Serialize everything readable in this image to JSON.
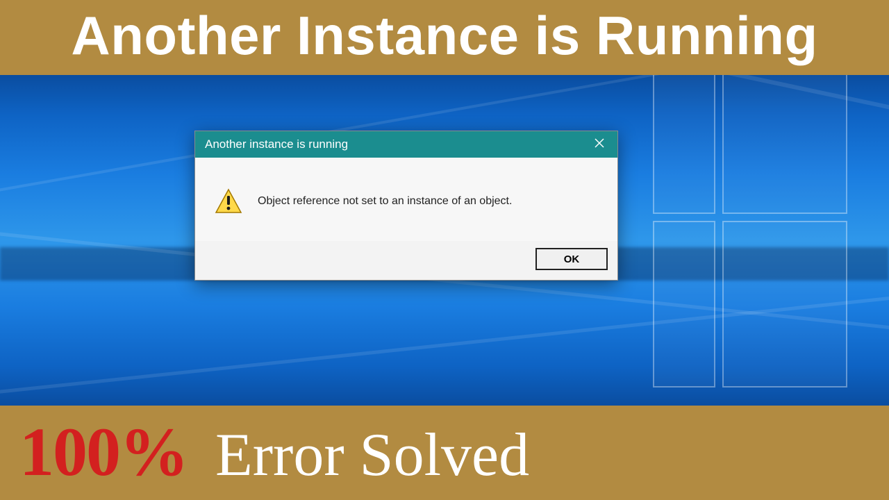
{
  "banner": {
    "top": "Another Instance is Running",
    "percent": "100%",
    "solved": "Error Solved"
  },
  "dialog": {
    "title": "Another instance is running",
    "message": "Object reference not set to an instance of an object.",
    "ok_label": "OK",
    "close_icon": "close-icon",
    "warn_icon": "warning-icon"
  },
  "colors": {
    "frame_bg": "#b28b41",
    "titlebar": "#1b8d8f",
    "percent": "#d3201f"
  }
}
